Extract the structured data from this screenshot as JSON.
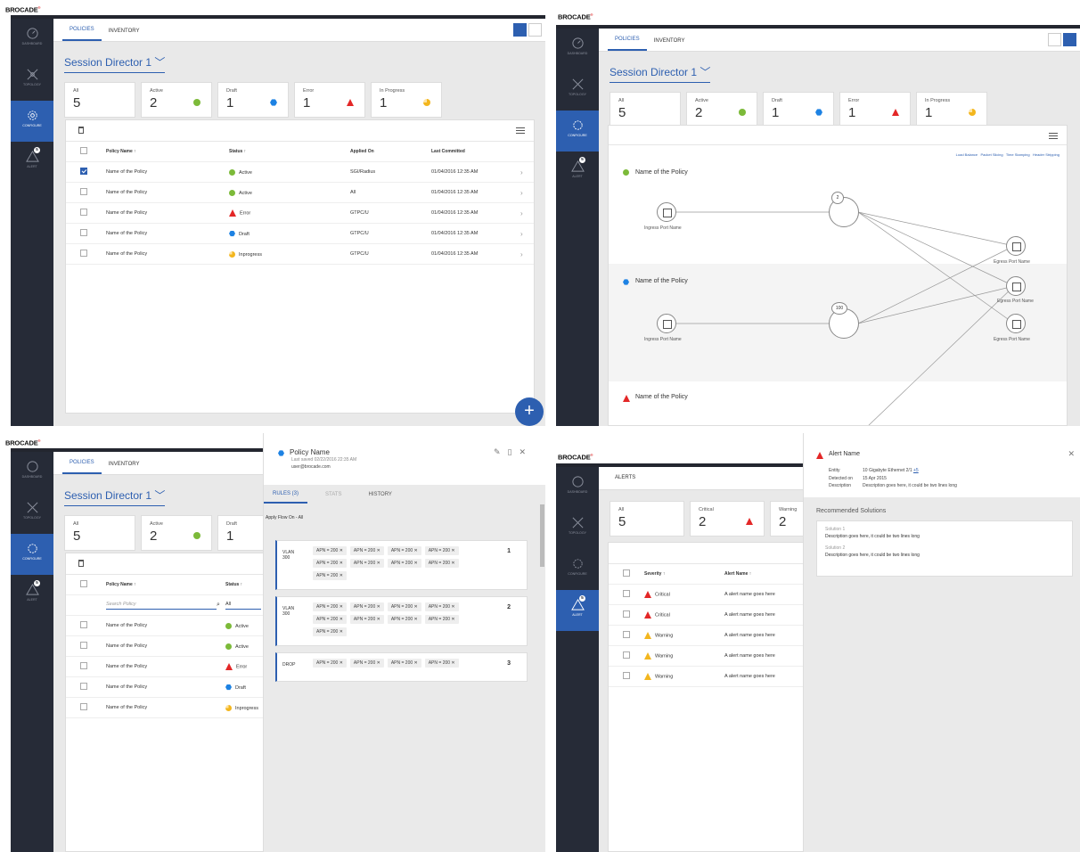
{
  "brand": {
    "name": "BROCADE",
    "mark": "®"
  },
  "nav": [
    {
      "label": "DASHBOARD",
      "icon": "dashboard-icon"
    },
    {
      "label": "TOPOLOGY",
      "icon": "topology-icon"
    },
    {
      "label": "CONFIGURE",
      "icon": "configure-icon"
    },
    {
      "label": "ALERT",
      "icon": "alert-icon",
      "badge": "5"
    }
  ],
  "tabs": {
    "policies": "POLICIES",
    "inventory": "INVENTORY",
    "alerts": "ALERTS"
  },
  "session": "Session Director 1 ﹀",
  "cards": [
    {
      "label": "All",
      "value": "5"
    },
    {
      "label": "Active",
      "value": "2",
      "color": "#7cba39"
    },
    {
      "label": "Draft",
      "value": "1",
      "color": "#1d82e3"
    },
    {
      "label": "Error",
      "value": "1",
      "color": "#e32727"
    },
    {
      "label": "In Progress",
      "value": "1",
      "color": "#f3b61e"
    }
  ],
  "table": {
    "headers": [
      "Policy Name ↑",
      "Status ↑",
      "Applied On",
      "Last Committed"
    ],
    "rows": [
      {
        "name": "Name of the Policy",
        "status": "Active",
        "applied": "SGI/Radius",
        "date": "01/04/2016  12:35 AM",
        "checked": true
      },
      {
        "name": "Name of the Policy",
        "status": "Active",
        "applied": "All",
        "date": "01/04/2016  12:35 AM"
      },
      {
        "name": "Name of the Policy",
        "status": "Error",
        "applied": "GTPC/U",
        "date": "01/04/2016  12:35 AM"
      },
      {
        "name": "Name of the Policy",
        "status": "Draft",
        "applied": "GTPC/U",
        "date": "01/04/2016  12:35 AM"
      },
      {
        "name": "Name of the Policy",
        "status": "Inprogress",
        "applied": "GTPC/U",
        "date": "01/04/2016  12:35 AM"
      }
    ]
  },
  "fab": "+",
  "topo": {
    "legend": [
      "Load Balance",
      "Packet Slicing",
      "Time Stamping",
      "Header Stripping"
    ],
    "policies": [
      "Name of the Policy",
      "Name of the Policy",
      "Name of the Policy"
    ],
    "ingress": "Ingress Port Name",
    "egress": "Egress Port Name",
    "n1": "2",
    "n2": "100"
  },
  "detail": {
    "title": "Policy Name",
    "saved": "Last saved 02/22/2016  22:35 AM",
    "user": "user@brocade.com",
    "tabs": [
      "RULES (3)",
      "STATS",
      "HISTORY"
    ],
    "apply": "Apply Flow On - All",
    "search": "Search Policy",
    "all": "All",
    "rules": [
      {
        "action": "VLAN\n300",
        "num": "1"
      },
      {
        "action": "VLAN\n300",
        "num": "2"
      },
      {
        "action": "DROP",
        "num": "3"
      }
    ],
    "chip": "APN = 200  ✕"
  },
  "alerts": {
    "cards": [
      {
        "label": "All",
        "value": "5"
      },
      {
        "label": "Critical",
        "value": "2"
      },
      {
        "label": "Warning",
        "value": "2"
      }
    ],
    "headers": [
      "Severity ↑",
      "Alert Name ↑"
    ],
    "rows": [
      {
        "sev": "Critical",
        "name": "A alert name goes here"
      },
      {
        "sev": "Critical",
        "name": "A alert name goes here"
      },
      {
        "sev": "Warning",
        "name": "A alert name goes here"
      },
      {
        "sev": "Warning",
        "name": "A alert name goes here"
      },
      {
        "sev": "Warning",
        "name": "A alert name goes here"
      }
    ],
    "detail": {
      "title": "Alert Name",
      "entity_l": "Entity",
      "entity": "10 Gigabyte Ethernet 2/1",
      "more": "+5",
      "det_l": "Detected on",
      "det": "15 Apr 2015",
      "desc_l": "Description",
      "desc": "Description goes here, it could be two lines long",
      "rec": "Recommended Solutions",
      "s1": "Solution 1",
      "s1d": "Description goes here, it could be two lines long",
      "s2": "Solution 2",
      "s2d": "Description goes here, it could be two lines long"
    }
  }
}
